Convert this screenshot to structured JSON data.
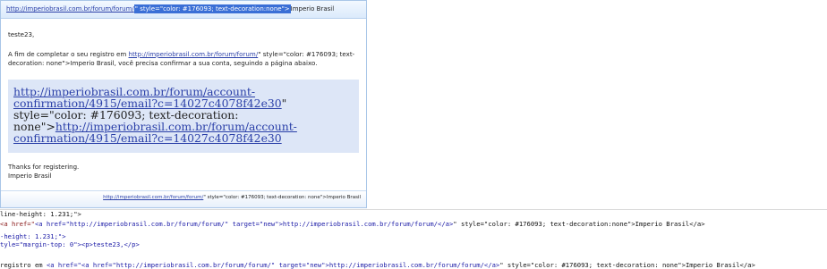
{
  "email": {
    "header": {
      "link": "http://imperiobrasil.com.br/forum/forum/",
      "highlighted": "\" style=\"color: #176093; text-decoration:none\">",
      "suffix": "Imperio Brasil"
    },
    "greeting": "teste23,",
    "intro_before": "A fim de completar o seu registro em ",
    "intro_link": "http://imperiobrasil.com.br/forum/forum/",
    "intro_after": "\" style=\"color: #176093; text-decoration: none\">Imperio Brasil, você precisa confirmar a sua conta, seguindo a página abaixo.",
    "confirm": {
      "link1": "http://imperiobrasil.com.br/forum/account-confirmation/4915/email?c=14027c4078f42e30",
      "mid": "\" style=\"color: #176093; text-decoration: none\">",
      "link2": "http://imperiobrasil.com.br/forum/account-confirmation/4915/email?c=14027c4078f42e30"
    },
    "thanks": "Thanks for registering.",
    "signature": "Imperio Brasil",
    "footer": {
      "link": "http://imperiobrasil.com.br/forum/forum/",
      "rest": "\" style=\"color: #176093; text-decoration: none\">Imperio Brasil"
    }
  },
  "source": {
    "line1": "line-height: 1.231;\">",
    "line2_prefix": "<a href=\"",
    "line2_mid1": "<a href=\"http://imperiobrasil.com.br/forum/forum/\" target=\"new\">http://imperiobrasil.com.br/forum/forum/</a>",
    "line2_rest": "\" style=\"color: #176093; text-decoration:none\">Imperio Brasil</a>",
    "line3": "-height: 1.231;\">",
    "line4": "tyle=\"margin-top: 0\"><p>teste23,</p>",
    "line5_prefix": "registro em ",
    "line5_mid": "<a href=\"<a href=\"http://imperiobrasil.com.br/forum/forum/\" target=\"new\">http://imperiobrasil.com.br/forum/forum/</a>",
    "line5_rest": "\" style=\"color: #176093; text-decoration: none\">Imperio Brasil</a>"
  }
}
